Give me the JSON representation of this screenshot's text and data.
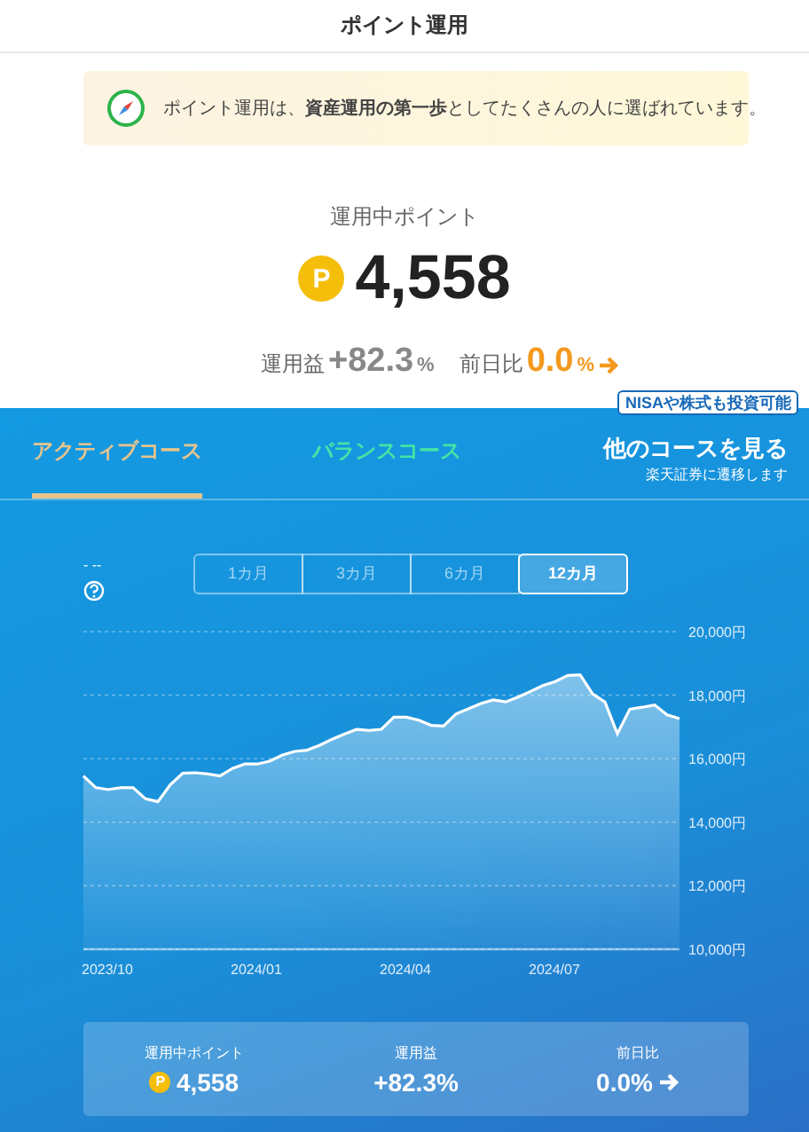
{
  "header": {
    "title": "ポイント運用"
  },
  "banner": {
    "text": "ポイント運用は、**資産運用の第一歩**としてたくさんの人に選ばれています。"
  },
  "summary": {
    "label": "運用中ポイント",
    "coin": "P",
    "points": "4,558",
    "profit_label": "運用益",
    "profit": "+82.3",
    "profit_unit": "%",
    "change_label": "前日比",
    "change": "0.0",
    "change_unit": "%"
  },
  "course_tabs": [
    {
      "label": "アクティブコース",
      "selected": true
    },
    {
      "label": "バランスコース",
      "selected": false
    }
  ],
  "other_course": {
    "badge": "NISAや株式も投資可能",
    "title": "他のコースを見る",
    "note": "楽天証券に遷移します"
  },
  "chart_caption": "- --",
  "periods": [
    {
      "label": "1カ月",
      "selected": false
    },
    {
      "label": "3カ月",
      "selected": false
    },
    {
      "label": "6カ月",
      "selected": false
    },
    {
      "label": "12カ月",
      "selected": true
    }
  ],
  "chart_data": {
    "type": "area",
    "grid": true,
    "ylim": [
      10000,
      20000
    ],
    "categories": [
      null,
      null,
      "2023/10",
      null,
      null,
      null,
      null,
      null,
      null,
      null,
      null,
      null,
      null,
      null,
      "2024/01",
      null,
      null,
      null,
      null,
      null,
      null,
      null,
      null,
      null,
      null,
      null,
      "2024/04",
      null,
      null,
      null,
      null,
      null,
      null,
      null,
      null,
      null,
      null,
      null,
      "2024/07",
      null,
      null,
      null,
      null,
      null,
      null,
      null,
      null,
      null,
      null
    ],
    "yticks": [
      {
        "value": 10000,
        "label": "10,000円"
      },
      {
        "value": 12000,
        "label": "12,000円"
      },
      {
        "value": 14000,
        "label": "14,000円"
      },
      {
        "value": 16000,
        "label": "16,000円"
      },
      {
        "value": 18000,
        "label": "18,000円"
      },
      {
        "value": 20000,
        "label": "20,000円"
      }
    ],
    "series": [
      {
        "color": "#ffffff",
        "values": [
          15460,
          15090,
          15030,
          15090,
          15090,
          14740,
          14650,
          15180,
          15540,
          15560,
          15520,
          15460,
          15690,
          15830,
          15830,
          15920,
          16110,
          16230,
          16270,
          16420,
          16610,
          16770,
          16920,
          16890,
          16930,
          17310,
          17310,
          17210,
          17050,
          17030,
          17410,
          17570,
          17740,
          17850,
          17790,
          17940,
          18120,
          18300,
          18430,
          18620,
          18640,
          18040,
          17780,
          16790,
          17560,
          17620,
          17690,
          17380,
          17260
        ]
      }
    ]
  },
  "summary_card": [
    {
      "label": "運用中ポイント",
      "coin": "P",
      "value": "4,558"
    },
    {
      "label": "運用益",
      "value": "+82.3%"
    },
    {
      "label": "前日比",
      "value": "0.0%",
      "arrow": true
    }
  ]
}
